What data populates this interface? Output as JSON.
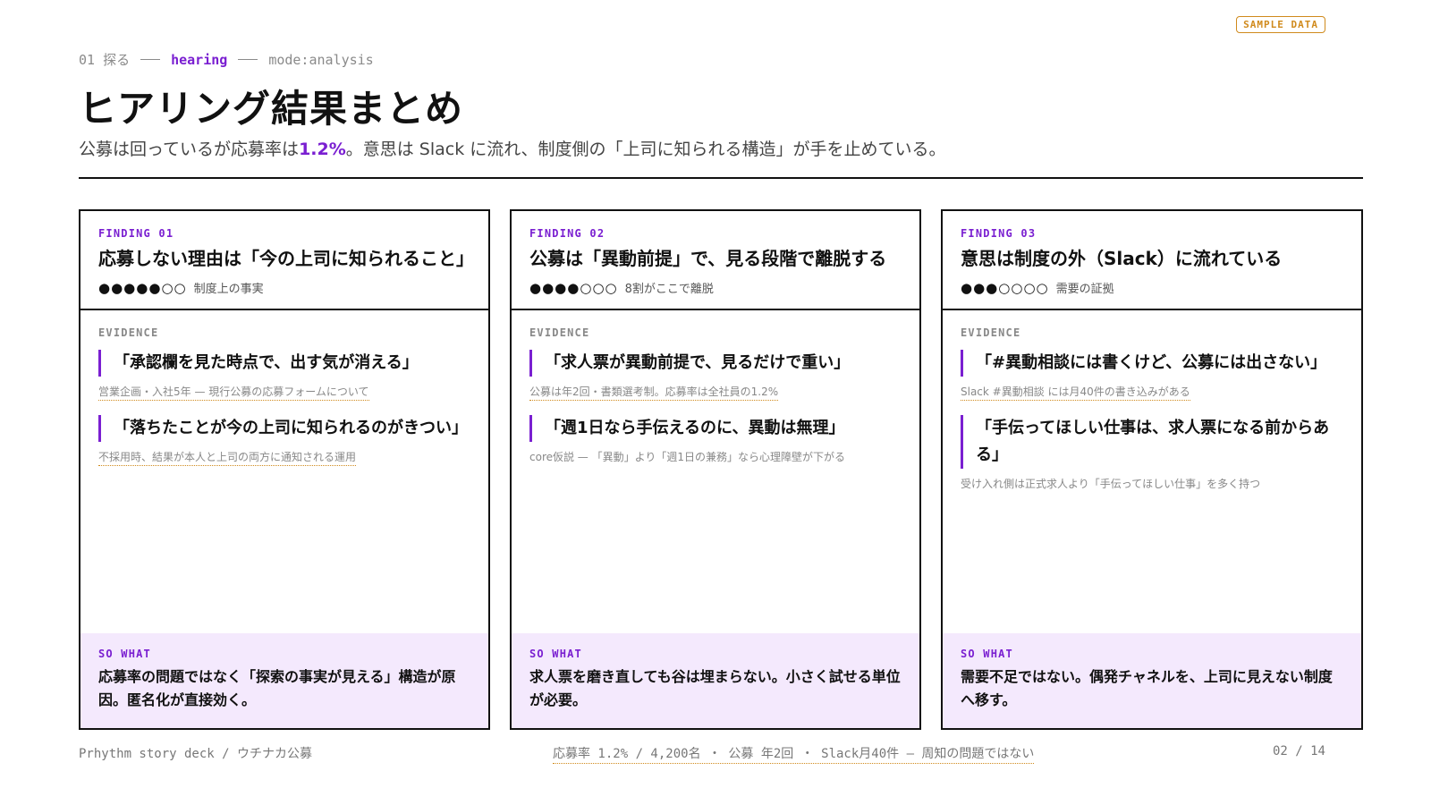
{
  "badge": "SAMPLE DATA",
  "breadcrumb": {
    "step": "01 探る",
    "active": "hearing",
    "mode": "mode:analysis"
  },
  "title": "ヒアリング結果まとめ",
  "lead": {
    "before": "公募は回っているが応募率は",
    "highlight": "1.2%",
    "after": "。意思は Slack に流れ、制度側の「上司に知られる構造」が手を止めている。"
  },
  "labels": {
    "evidence": "EVIDENCE",
    "so_what": "SO WHAT"
  },
  "findings": [
    {
      "kicker": "FINDING 01",
      "title": "応募しない理由は「今の上司に知られること」",
      "dots": "●●●●●○○",
      "rating_label": "制度上の事実",
      "evidence": [
        {
          "quote": "「承認欄を見た時点で、出す気が消える」",
          "source": "営業企画・入社5年 — 現行公募の応募フォームについて"
        },
        {
          "quote": "「落ちたことが今の上司に知られるのがきつい」",
          "source": "不採用時、結果が本人と上司の両方に通知される運用"
        }
      ],
      "so_what": "応募率の問題ではなく「探索の事実が見える」構造が原因。匿名化が直接効く。"
    },
    {
      "kicker": "FINDING 02",
      "title": "公募は「異動前提」で、見る段階で離脱する",
      "dots": "●●●●○○○",
      "rating_label": "8割がここで離脱",
      "evidence": [
        {
          "quote": "「求人票が異動前提で、見るだけで重い」",
          "source": "公募は年2回・書類選考制。応募率は全社員の1.2%"
        },
        {
          "quote": "「週1日なら手伝えるのに、異動は無理」",
          "source": "core仮説 — 「異動」より「週1日の兼務」なら心理障壁が下がる"
        }
      ],
      "so_what": "求人票を磨き直しても谷は埋まらない。小さく試せる単位が必要。"
    },
    {
      "kicker": "FINDING 03",
      "title": "意思は制度の外（Slack）に流れている",
      "dots": "●●●○○○○",
      "rating_label": "需要の証拠",
      "evidence": [
        {
          "quote": "「#異動相談には書くけど、公募には出さない」",
          "source": "Slack #異動相談 には月40件の書き込みがある"
        },
        {
          "quote": "「手伝ってほしい仕事は、求人票になる前からある」",
          "source": "受け入れ側は正式求人より「手伝ってほしい仕事」を多く持つ"
        }
      ],
      "so_what": "需要不足ではない。偶発チャネルを、上司に見えない制度へ移す。"
    }
  ],
  "footer": {
    "left": "Prhythm story deck / ウチナカ公募",
    "center": "応募率 1.2% / 4,200名 ・ 公募 年2回 ・ Slack月40件 — 周知の問題ではない",
    "page": "02 / 14"
  },
  "colors": {
    "accent": "#7a1fd1",
    "underline": "#d08a1c",
    "so_what_bg": "#f4e9fd"
  }
}
